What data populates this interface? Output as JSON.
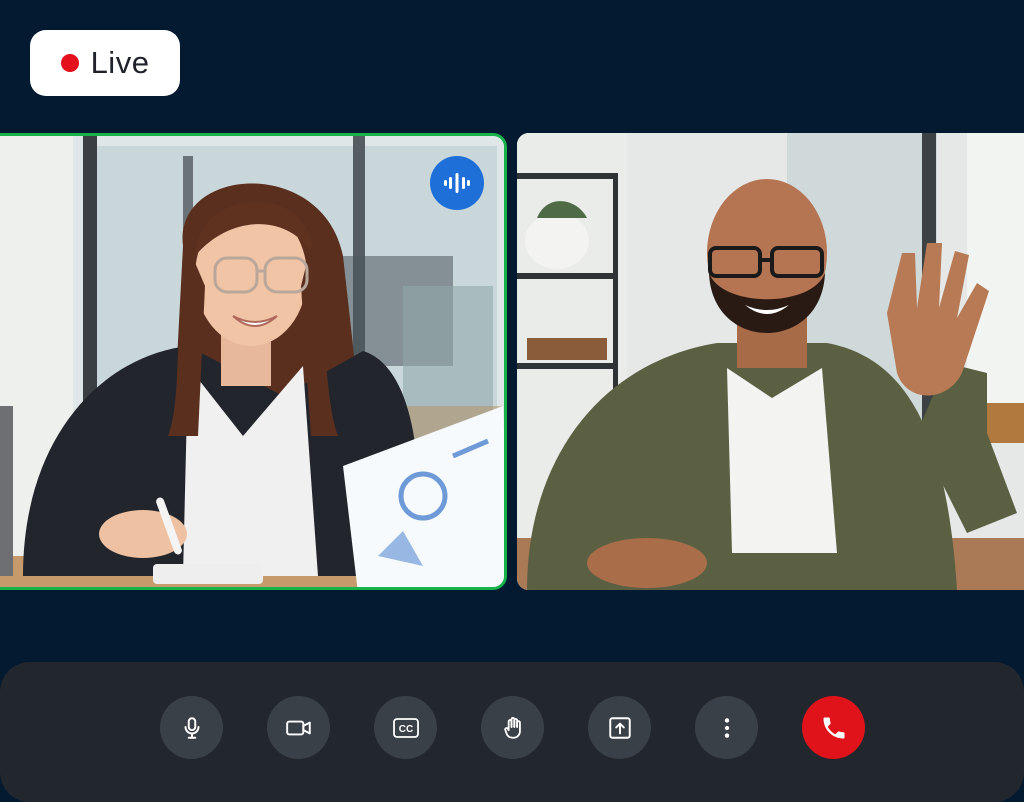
{
  "status": {
    "live_label": "Live",
    "live_color": "#e4101b"
  },
  "participants": [
    {
      "id": "participant-1",
      "speaking": true,
      "speaking_icon": "audio-wave-icon",
      "highlight_color": "#15b34a"
    },
    {
      "id": "participant-2",
      "speaking": false
    }
  ],
  "controls": [
    {
      "name": "microphone",
      "icon": "microphone-icon"
    },
    {
      "name": "camera",
      "icon": "video-camera-icon"
    },
    {
      "name": "captions",
      "icon": "closed-captions-icon",
      "label": "CC"
    },
    {
      "name": "raise-hand",
      "icon": "hand-icon"
    },
    {
      "name": "share-screen",
      "icon": "share-screen-icon"
    },
    {
      "name": "more-options",
      "icon": "more-vertical-icon"
    },
    {
      "name": "end-call",
      "icon": "phone-hangup-icon",
      "color": "#e0131b"
    }
  ],
  "colors": {
    "background": "#031a30",
    "control_bar": "#22272d",
    "control_button": "#3a4047",
    "speaking_badge": "#1f6fd8"
  }
}
